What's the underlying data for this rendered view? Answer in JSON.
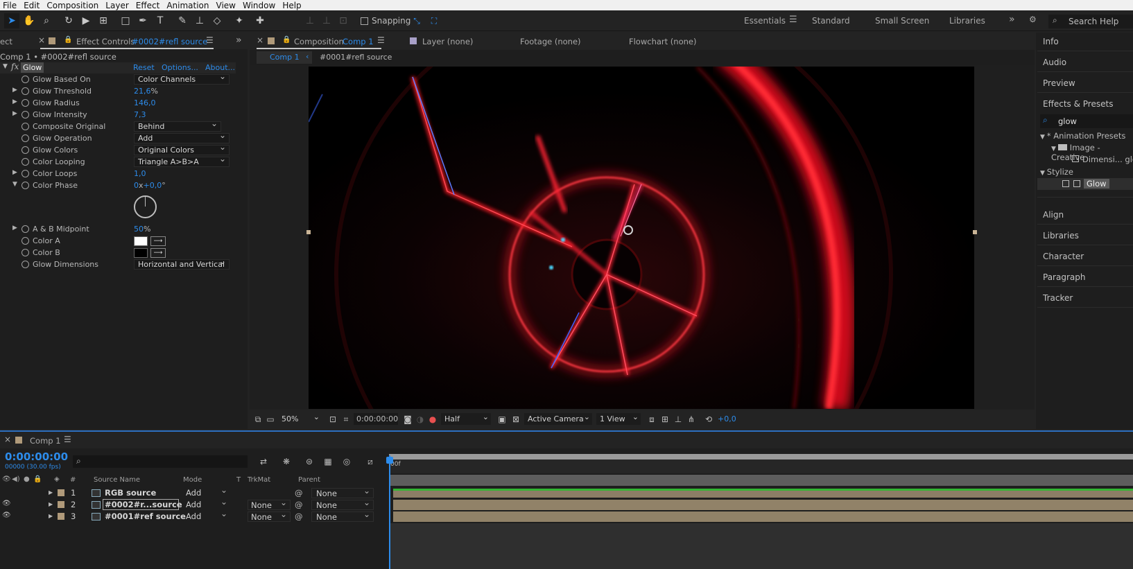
{
  "menu": [
    "File",
    "Edit",
    "Composition",
    "Layer",
    "Effect",
    "Animation",
    "View",
    "Window",
    "Help"
  ],
  "toolbar": {
    "snapping_label": "Snapping",
    "workspaces": [
      "Essentials",
      "Standard",
      "Small Screen",
      "Libraries"
    ],
    "active_workspace": "Essentials",
    "search_placeholder": "Search Help"
  },
  "effect_controls": {
    "prev_tab_label": "ect",
    "tab_label": "Effect Controls",
    "tab_layer": "#0002#refl source",
    "breadcrumb": "Comp 1 • #0002#refl source",
    "fx_label": "fx",
    "effect_name": "Glow",
    "reset_label": "Reset",
    "options_label": "Options...",
    "about_label": "About...",
    "properties": [
      {
        "name": "Glow Based On",
        "dropdown": "Color Channels"
      },
      {
        "name": "Glow Threshold",
        "value": "21,6",
        "unit": "%"
      },
      {
        "name": "Glow Radius",
        "value": "146,0"
      },
      {
        "name": "Glow Intensity",
        "value": "7,3"
      },
      {
        "name": "Composite Original",
        "dropdown": "Behind"
      },
      {
        "name": "Glow Operation",
        "dropdown": "Add"
      },
      {
        "name": "Glow Colors",
        "dropdown": "Original Colors"
      },
      {
        "name": "Color Looping",
        "dropdown": "Triangle A>B>A"
      },
      {
        "name": "Color Loops",
        "value": "1,0"
      },
      {
        "name": "Color Phase",
        "value_rev": "0",
        "value_x": "x",
        "value_deg": "+0,0",
        "value_unit": "°"
      },
      {
        "name": "A & B Midpoint",
        "value": "50",
        "unit": "%"
      },
      {
        "name": "Color A",
        "color": "#ffffff"
      },
      {
        "name": "Color B",
        "color": "#000000"
      },
      {
        "name": "Glow Dimensions",
        "dropdown": "Horizontal and Vertical"
      }
    ]
  },
  "composition_panel": {
    "tab_label": "Composition",
    "tab_comp": "Comp 1",
    "layer_tab": "Layer (none)",
    "footage_tab": "Footage (none)",
    "flowchart_tab": "Flowchart (none)",
    "crumb_comp": "Comp 1",
    "crumb_layer": "#0001#refl source",
    "viewer_bar": {
      "zoom": "50%",
      "timecode": "0:00:00:00",
      "resolution": "Half",
      "camera": "Active Camera",
      "views": "1 View",
      "exposure": "+0,0"
    }
  },
  "right_panel": {
    "items_top": [
      "Info",
      "Audio",
      "Preview",
      "Effects & Presets"
    ],
    "search_value": "glow",
    "tree": {
      "animation_presets": "* Animation Presets",
      "image_creative": "Image - Creative",
      "dimensions": "Dimensi... glo",
      "stylize": "Stylize",
      "glow": "Glow"
    },
    "items_bottom": [
      "Align",
      "Libraries",
      "Character",
      "Paragraph",
      "Tracker"
    ]
  },
  "timeline": {
    "tab_label": "Comp 1",
    "timecode": "0:00:00:00",
    "frame_info": "00000 (30.00 fps)",
    "ruler_label": "00f",
    "columns": {
      "num": "#",
      "source": "Source Name",
      "mode": "Mode",
      "t": "T",
      "trkmat": "TrkMat",
      "parent": "Parent"
    },
    "layers": [
      {
        "num": "1",
        "name": "RGB source",
        "mode": "Add",
        "trkmat": "",
        "parent": "None"
      },
      {
        "num": "2",
        "name": "#0002#r...source",
        "mode": "Add",
        "trkmat": "None",
        "parent": "None"
      },
      {
        "num": "3",
        "name": "#0001#ref source",
        "mode": "Add",
        "trkmat": "None",
        "parent": "None"
      }
    ]
  },
  "colors": {
    "accent": "#2d8ceb",
    "label_tan": "#b09a7a",
    "layer_bar": "#918268",
    "work_area": "#9a9a9a",
    "green_line": "#33b533"
  }
}
